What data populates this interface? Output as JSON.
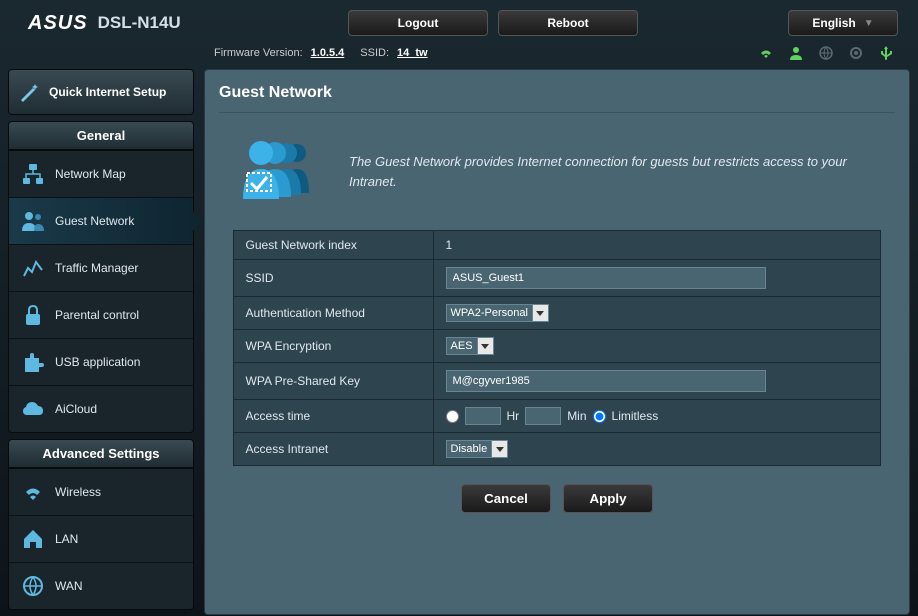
{
  "header": {
    "brand": "ASUS",
    "model": "DSL-N14U",
    "logout": "Logout",
    "reboot": "Reboot",
    "language": "English"
  },
  "infoBar": {
    "firmwareLabel": "Firmware Version:",
    "firmware": "1.0.5.4",
    "ssidLabel": "SSID:",
    "ssid": "14_tw"
  },
  "sidebar": {
    "qis": "Quick Internet Setup",
    "generalHeader": "General",
    "general": [
      {
        "label": "Network Map"
      },
      {
        "label": "Guest Network"
      },
      {
        "label": "Traffic Manager"
      },
      {
        "label": "Parental control"
      },
      {
        "label": "USB application"
      },
      {
        "label": "AiCloud"
      }
    ],
    "advancedHeader": "Advanced Settings",
    "advanced": [
      {
        "label": "Wireless"
      },
      {
        "label": "LAN"
      },
      {
        "label": "WAN"
      }
    ]
  },
  "page": {
    "title": "Guest Network",
    "intro": "The Guest Network provides Internet connection for guests but restricts access to your Intranet.",
    "fields": {
      "indexLabel": "Guest Network index",
      "indexValue": "1",
      "ssidLabel": "SSID",
      "ssidValue": "ASUS_Guest1",
      "authLabel": "Authentication Method",
      "authValue": "WPA2-Personal",
      "encLabel": "WPA Encryption",
      "encValue": "AES",
      "pskLabel": "WPA Pre-Shared Key",
      "pskValue": "M@cgyver1985",
      "timeLabel": "Access time",
      "hrLabel": "Hr",
      "minLabel": "Min",
      "limitless": "Limitless",
      "intranetLabel": "Access Intranet",
      "intranetValue": "Disable"
    },
    "buttons": {
      "cancel": "Cancel",
      "apply": "Apply"
    }
  }
}
